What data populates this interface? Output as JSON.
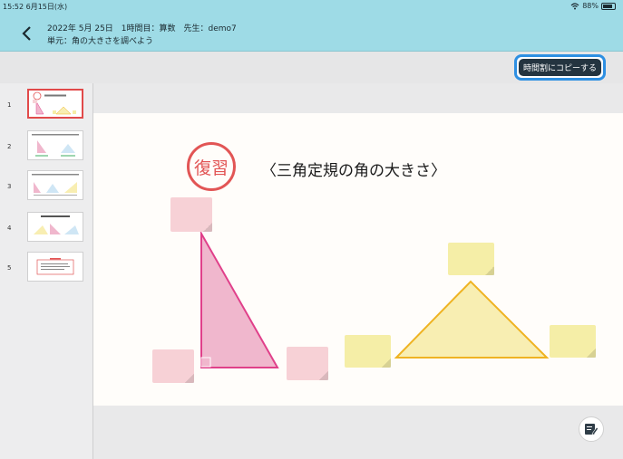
{
  "status": {
    "time": "15:52",
    "date": "6月15日(水)",
    "battery": "88%"
  },
  "header": {
    "line1": "2022年 5月 25日　1時間目：算数　先生：demo7",
    "line2": "単元：角の大きさを調べよう",
    "back_icon": "chevron-left-icon"
  },
  "toolbar": {
    "copy_button_label": "時間割にコピーする"
  },
  "sidebar": {
    "thumbnails": [
      {
        "number": "1"
      },
      {
        "number": "2"
      },
      {
        "number": "3"
      },
      {
        "number": "4"
      },
      {
        "number": "5"
      }
    ]
  },
  "slide": {
    "badge": "復習",
    "title": "〈三角定規の角の大きさ〉"
  },
  "colors": {
    "accent_blue": "#2e8fe2",
    "badge_red": "#e25555",
    "triangle_pink": "#e0408a",
    "triangle_yellow": "#efb323"
  }
}
